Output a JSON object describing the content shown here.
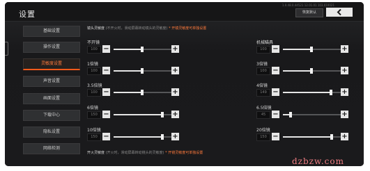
{
  "header": {
    "title": "设置",
    "version": "1.0.48.0.44521 12.01.01 103.010021",
    "reset_label": "恢复默认",
    "back_icon": "chevron-left-icon"
  },
  "sidebar": {
    "items": [
      {
        "label": "基础设置",
        "active": false
      },
      {
        "label": "操作设置",
        "active": false
      },
      {
        "label": "灵敏度设置",
        "active": true
      },
      {
        "label": "声音设置",
        "active": false
      },
      {
        "label": "画面设置",
        "active": false
      },
      {
        "label": "下载中心",
        "active": false
      },
      {
        "label": "隐私设置",
        "active": false
      },
      {
        "label": "网络检测",
        "active": false
      }
    ]
  },
  "section_top": {
    "title": "镜头灵敏度",
    "note": "(不开火时，滑动屏幕转动镜头的灵敏度)",
    "hint": "* 开镜灵敏度可单独设置"
  },
  "section_bottom": {
    "title": "开火灵敏度",
    "note": "(开火时，滑动屏幕转动镜头的灵敏度)",
    "hint": "* 开镜灵敏度可单独设置"
  },
  "sliders_left": [
    {
      "label": "不开镜",
      "value": "100",
      "level": 0.45
    },
    {
      "label": "1倍镜",
      "value": "100",
      "level": 0.45
    },
    {
      "label": "3.5倍镜",
      "value": "100",
      "level": 0.45
    },
    {
      "label": "6倍镜",
      "value": "150",
      "level": 0.78
    },
    {
      "label": "10倍镜",
      "value": "150",
      "level": 0.78
    }
  ],
  "sliders_right": [
    {
      "label": "机械瞄具",
      "value": "100",
      "level": 0.45
    },
    {
      "label": "3倍镜",
      "value": "100",
      "level": 0.45
    },
    {
      "label": "4倍镜",
      "value": "149",
      "level": 0.77
    },
    {
      "label": "6.5倍镜",
      "value": "45",
      "level": 0.12
    },
    {
      "label": "20倍镜",
      "value": "150",
      "level": 0.78
    }
  ],
  "controls": {
    "minus": "−",
    "plus": "+"
  },
  "watermark": "dzbzw.com",
  "colors": {
    "accent": "#ff5a1a",
    "background": "#1a1b1d",
    "button": "#e6e6e6"
  }
}
